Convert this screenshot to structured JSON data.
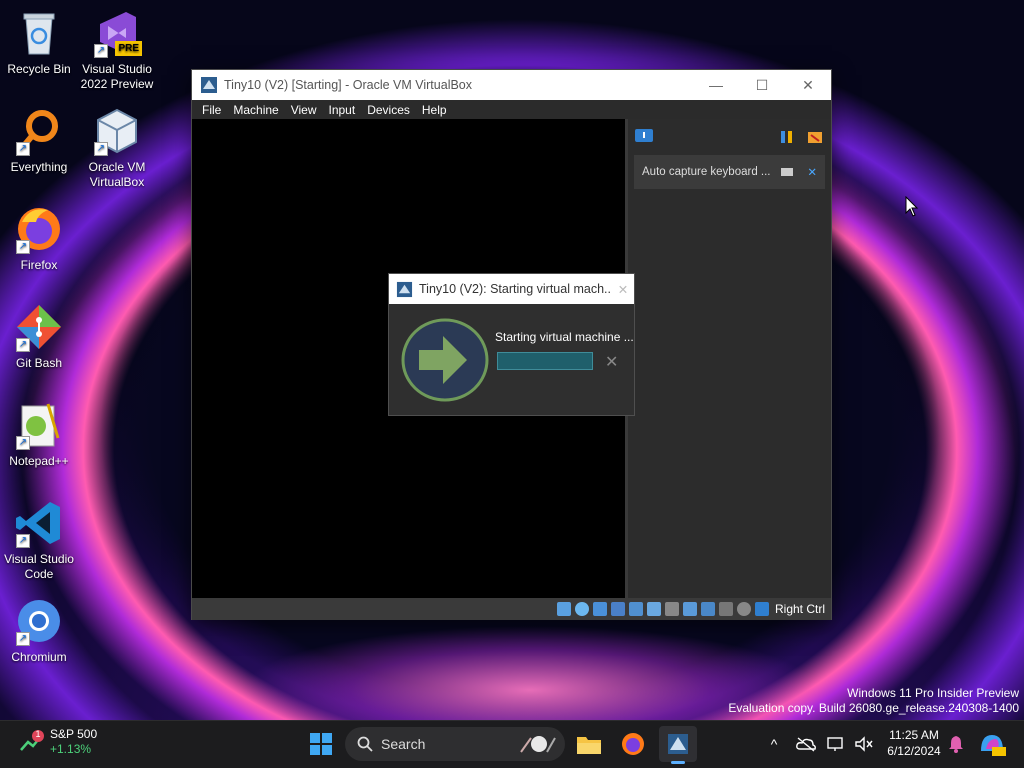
{
  "desktop": {
    "icons": [
      {
        "label": "Recycle Bin",
        "icon": "recycle-bin-icon"
      },
      {
        "label": "Visual Studio 2022 Preview",
        "icon": "visual-studio-preview-icon",
        "badge": "PRE"
      },
      {
        "label": "Everything",
        "icon": "everything-search-icon"
      },
      {
        "label": "Oracle VM VirtualBox",
        "icon": "virtualbox-icon"
      },
      {
        "label": "Firefox",
        "icon": "firefox-icon"
      },
      {
        "label": "Git Bash",
        "icon": "git-bash-icon"
      },
      {
        "label": "Notepad++",
        "icon": "notepad-plus-plus-icon"
      },
      {
        "label": "Visual Studio Code",
        "icon": "vscode-icon"
      },
      {
        "label": "Chromium",
        "icon": "chromium-icon"
      }
    ]
  },
  "vbox_window": {
    "title": "Tiny10 (V2) [Starting] - Oracle VM VirtualBox",
    "controls": {
      "minimize": "—",
      "maximize": "☐",
      "close": "✕"
    },
    "menu": [
      "File",
      "Machine",
      "View",
      "Input",
      "Devices",
      "Help"
    ],
    "notice": {
      "text": "Auto capture keyboard ...",
      "close": "✕"
    },
    "status": {
      "host_key": "Right Ctrl"
    }
  },
  "dialog": {
    "title": "Tiny10 (V2): Starting virtual mach...",
    "message": "Starting virtual machine ...",
    "progress": 0.0,
    "close_glyph": "✕",
    "cancel_glyph": "✕"
  },
  "watermark": {
    "line1": "Windows 11 Pro Insider Preview",
    "line2": "Evaluation copy. Build 26080.ge_release.240308-1400"
  },
  "taskbar": {
    "stock": {
      "name": "S&P 500",
      "change": "+1.13%",
      "badge": "1"
    },
    "search_placeholder": "Search",
    "tray_caret": "^",
    "clock": {
      "time": "11:25 AM",
      "date": "6/12/2024"
    }
  },
  "colors": {
    "accent": "#1a6fd6",
    "progress": "#2b6f7b",
    "stock_up": "#4cd07a"
  }
}
